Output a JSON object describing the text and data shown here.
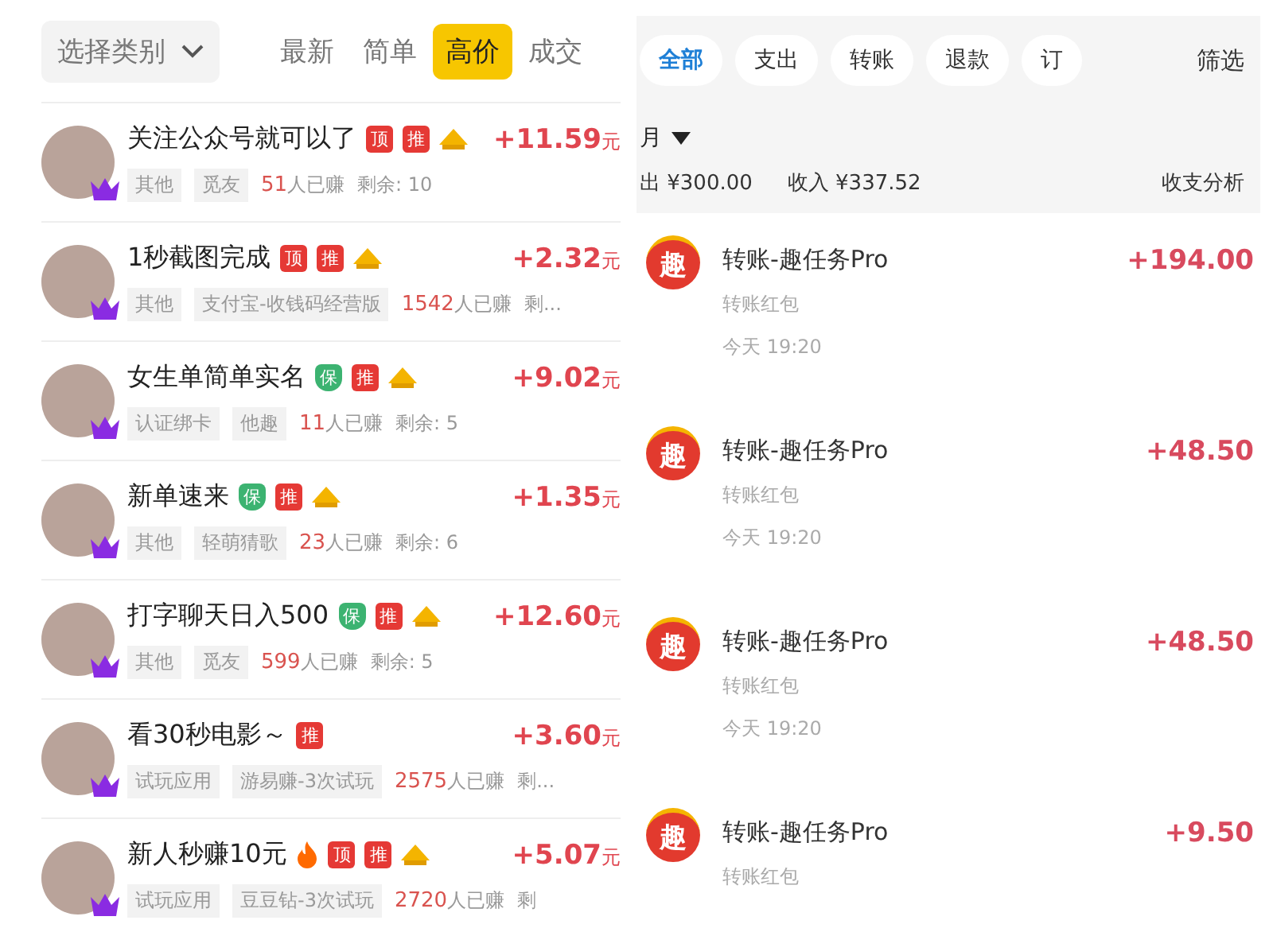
{
  "task_panel": {
    "category_select": {
      "label": "选择类别"
    },
    "sort_tabs": [
      {
        "label": "最新",
        "selected": false
      },
      {
        "label": "简单",
        "selected": false
      },
      {
        "label": "高价",
        "selected": true
      },
      {
        "label": "成交",
        "selected": false
      }
    ],
    "tasks": [
      {
        "title": "关注公众号就可以了",
        "badges": [
          {
            "kind": "top",
            "text": "顶"
          },
          {
            "kind": "rec",
            "text": "推"
          }
        ],
        "coin": true,
        "price": "+11.59",
        "unit": "元",
        "tags": [
          "其他",
          "觅友"
        ],
        "earned": "51",
        "earned_suffix": "人已赚",
        "remaining": "剩余: 10"
      },
      {
        "title": "1秒截图完成",
        "badges": [
          {
            "kind": "top",
            "text": "顶"
          },
          {
            "kind": "rec",
            "text": "推"
          }
        ],
        "coin": true,
        "price": "+2.32",
        "unit": "元",
        "tags": [
          "其他",
          "支付宝-收钱码经营版"
        ],
        "earned": "1542",
        "earned_suffix": "人已赚",
        "remaining": "剩..."
      },
      {
        "title": "女生单简单实名",
        "badges": [
          {
            "kind": "safe",
            "text": "保"
          },
          {
            "kind": "rec",
            "text": "推"
          }
        ],
        "coin": true,
        "price": "+9.02",
        "unit": "元",
        "tags": [
          "认证绑卡",
          "他趣"
        ],
        "earned": "11",
        "earned_suffix": "人已赚",
        "remaining": "剩余: 5"
      },
      {
        "title": "新单速来",
        "badges": [
          {
            "kind": "safe",
            "text": "保"
          },
          {
            "kind": "rec",
            "text": "推"
          }
        ],
        "coin": true,
        "price": "+1.35",
        "unit": "元",
        "tags": [
          "其他",
          "轻萌猜歌"
        ],
        "earned": "23",
        "earned_suffix": "人已赚",
        "remaining": "剩余: 6"
      },
      {
        "title": "打字聊天日入500",
        "badges": [
          {
            "kind": "safe",
            "text": "保"
          },
          {
            "kind": "rec",
            "text": "推"
          }
        ],
        "coin": true,
        "price": "+12.60",
        "unit": "元",
        "tags": [
          "其他",
          "觅友"
        ],
        "earned": "599",
        "earned_suffix": "人已赚",
        "remaining": "剩余: 5"
      },
      {
        "title": "看30秒电影～",
        "badges": [
          {
            "kind": "rec",
            "text": "推"
          }
        ],
        "coin": false,
        "price": "+3.60",
        "unit": "元",
        "tags": [
          "试玩应用",
          "游易赚-3次试玩"
        ],
        "earned": "2575",
        "earned_suffix": "人已赚",
        "remaining": "剩..."
      },
      {
        "title": "新人秒赚10元",
        "badges": [
          {
            "kind": "fire"
          },
          {
            "kind": "top",
            "text": "顶"
          },
          {
            "kind": "rec",
            "text": "推"
          }
        ],
        "coin": true,
        "price": "+5.07",
        "unit": "元",
        "tags": [
          "试玩应用",
          "豆豆钻-3次试玩"
        ],
        "earned": "2720",
        "earned_suffix": "人已赚",
        "remaining": "剩"
      }
    ]
  },
  "bill_panel": {
    "filters": [
      {
        "label": "全部",
        "selected": true
      },
      {
        "label": "支出",
        "selected": false
      },
      {
        "label": "转账",
        "selected": false
      },
      {
        "label": "退款",
        "selected": false
      },
      {
        "label": "订",
        "selected": false
      }
    ],
    "filter_button": "筛选",
    "month": "月",
    "expense": "出 ¥300.00",
    "income": "收入 ¥337.52",
    "analysis": "收支分析",
    "transactions": [
      {
        "logo": "趣",
        "title": "转账-趣任务Pro",
        "subtitle": "转账红包",
        "time": "今天 19:20",
        "amount": "+194.00"
      },
      {
        "logo": "趣",
        "title": "转账-趣任务Pro",
        "subtitle": "转账红包",
        "time": "今天 19:20",
        "amount": "+48.50"
      },
      {
        "logo": "趣",
        "title": "转账-趣任务Pro",
        "subtitle": "转账红包",
        "time": "今天 19:20",
        "amount": "+48.50"
      },
      {
        "logo": "趣",
        "title": "转账-趣任务Pro",
        "subtitle": "转账红包",
        "amount": "+9.50"
      }
    ]
  }
}
